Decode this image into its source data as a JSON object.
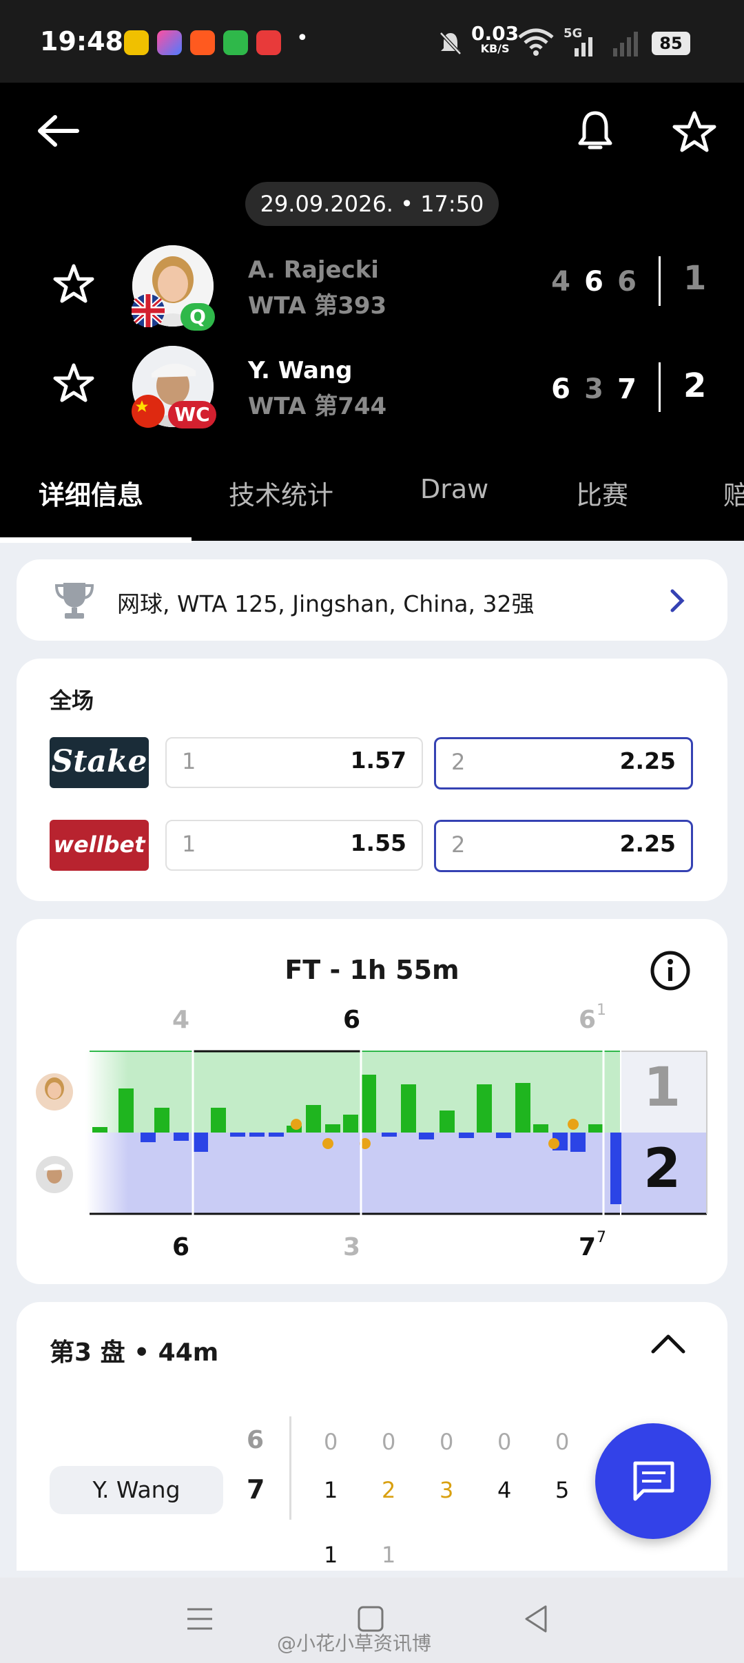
{
  "status_bar": {
    "time": "19:48",
    "net_speed_value": "0.03",
    "net_speed_unit": "KB/S",
    "network": "5G",
    "battery": "85",
    "dot": "•"
  },
  "header": {
    "datetime": "29.09.2026. • 17:50",
    "players": [
      {
        "name": "A. Rajecki",
        "rank": "WTA 第393",
        "badge": "Q",
        "sets": [
          "4",
          "6",
          "6"
        ],
        "total": "1"
      },
      {
        "name": "Y. Wang",
        "rank": "WTA 第744",
        "badge": "WC",
        "sets": [
          "6",
          "3",
          "7"
        ],
        "total": "2"
      }
    ]
  },
  "tabs": [
    "详细信息",
    "技术统计",
    "Draw",
    "比赛",
    "赔"
  ],
  "tournament": {
    "label": "网球, WTA 125, Jingshan, China, 32强"
  },
  "odds": {
    "title": "全场",
    "bookmakers": [
      {
        "name": "Stake",
        "logo_color": "#1a2c38",
        "home_key": "1",
        "home_odd": "1.57",
        "away_key": "2",
        "away_odd": "2.25"
      },
      {
        "name": "wellbet",
        "logo_color": "#b8232f",
        "home_key": "1",
        "home_odd": "1.55",
        "away_key": "2",
        "away_odd": "2.25"
      }
    ]
  },
  "momentum": {
    "title": "FT - 1h 55m",
    "top_sets": [
      "4",
      "6",
      "6"
    ],
    "top_tiebreak": "1",
    "bottom_sets": [
      "6",
      "3",
      "7"
    ],
    "bottom_tiebreak": "7",
    "set_score_top": "1",
    "set_score_bottom": "2",
    "colors": {
      "player1": "#1fb51f",
      "player2": "#2b44e6",
      "p1_area": "#c3ecc8",
      "p2_area": "#c9ccf5"
    }
  },
  "set3": {
    "title": "第3 盘 • 44m",
    "player": "Y. Wang",
    "opp_games": "6",
    "games": "7",
    "opp_points": [
      "0",
      "0",
      "0",
      "0",
      "0"
    ],
    "points": [
      "1",
      "2",
      "3",
      "4",
      "5"
    ],
    "extra_points": [
      "1",
      "1"
    ]
  },
  "watermark": "@小花小草资讯博"
}
